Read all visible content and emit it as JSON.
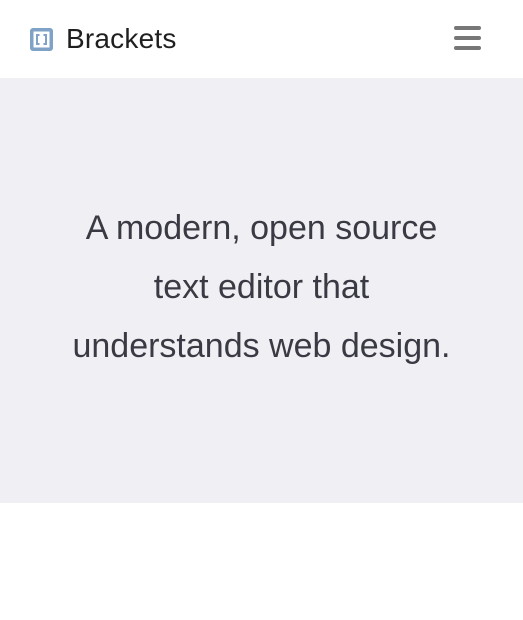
{
  "header": {
    "brand": {
      "name": "Brackets",
      "icon": "brackets-logo-icon"
    },
    "menu": {
      "icon": "hamburger-menu-icon"
    }
  },
  "hero": {
    "tagline": "A modern, open source text editor that understands web design."
  },
  "colors": {
    "hero_background": "#f0f0f4",
    "logo_accent": "#7fa2c6",
    "menu_icon": "#777777",
    "text": "#3a3a44"
  }
}
